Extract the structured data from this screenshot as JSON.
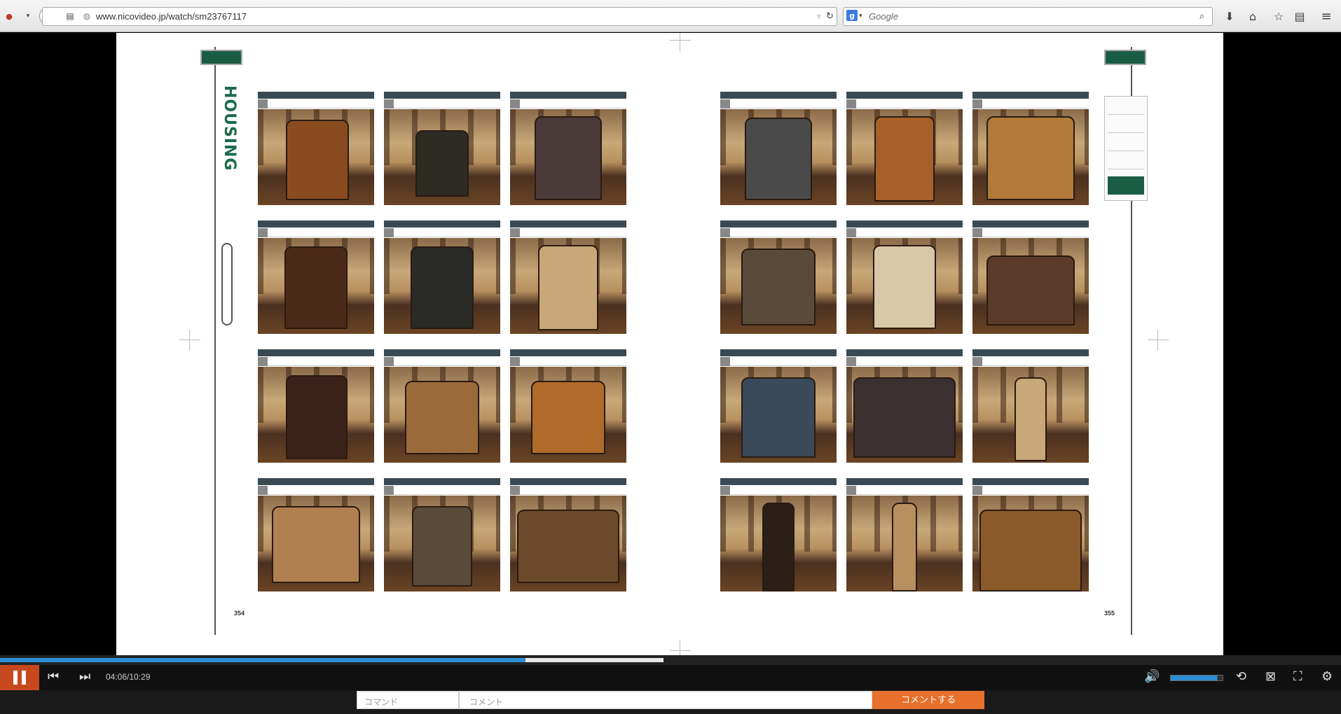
{
  "browser": {
    "url": "www.nicovideo.jp/watch/sm23767117",
    "search_placeholder": "Google"
  },
  "book": {
    "section_title": "HOUSING",
    "left_page_num": "354",
    "right_page_num": "355"
  },
  "player": {
    "time": "04:06/10:29",
    "played_fraction": 0.392,
    "buffered_fraction": 0.495,
    "volume_fraction": 0.9,
    "command_placeholder": "コマンド",
    "comment_placeholder": "コメント",
    "comment_button": "コメントする"
  },
  "colors": {
    "accent_green": "#1b5c45",
    "seek_blue": "#2c8fd6",
    "pause_orange": "#c8481e",
    "comment_orange": "#e6702c"
  }
}
